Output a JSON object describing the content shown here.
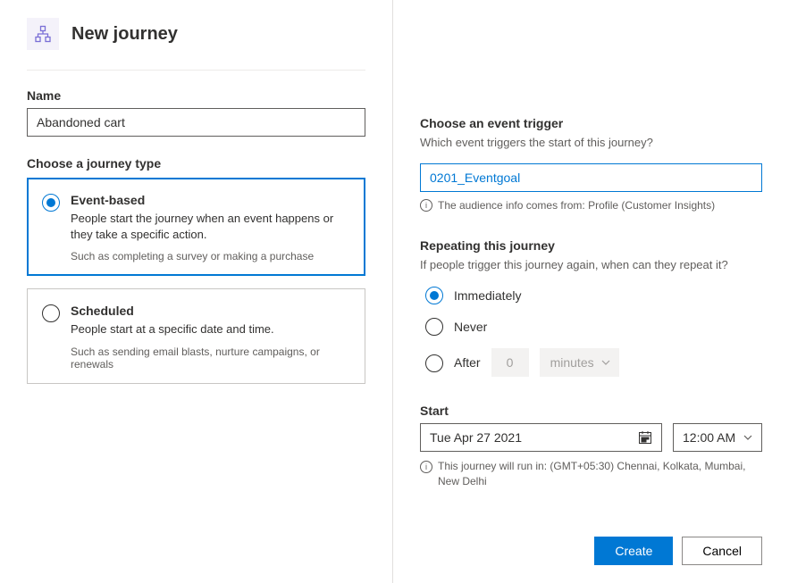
{
  "header": {
    "title": "New journey"
  },
  "name": {
    "label": "Name",
    "value": "Abandoned cart"
  },
  "journey_type": {
    "label": "Choose a journey type",
    "event_based": {
      "title": "Event-based",
      "desc": "People start the journey when an event happens or they take a specific action.",
      "example": "Such as completing a survey or making a purchase"
    },
    "scheduled": {
      "title": "Scheduled",
      "desc": "People start at a specific date and time.",
      "example": "Such as sending email blasts, nurture campaigns, or renewals"
    }
  },
  "trigger": {
    "label": "Choose an event trigger",
    "subtext": "Which event triggers the start of this journey?",
    "value": "0201_Eventgoal",
    "info": "The audience info comes from: Profile (Customer Insights)"
  },
  "repeat": {
    "label": "Repeating this journey",
    "subtext": "If people trigger this journey again, when can they repeat it?",
    "immediately": "Immediately",
    "never": "Never",
    "after": "After",
    "after_value": "0",
    "after_unit": "minutes"
  },
  "start": {
    "label": "Start",
    "date": "Tue Apr 27 2021",
    "time": "12:00 AM",
    "tz": "This journey will run in: (GMT+05:30) Chennai, Kolkata, Mumbai, New Delhi"
  },
  "footer": {
    "create": "Create",
    "cancel": "Cancel"
  }
}
